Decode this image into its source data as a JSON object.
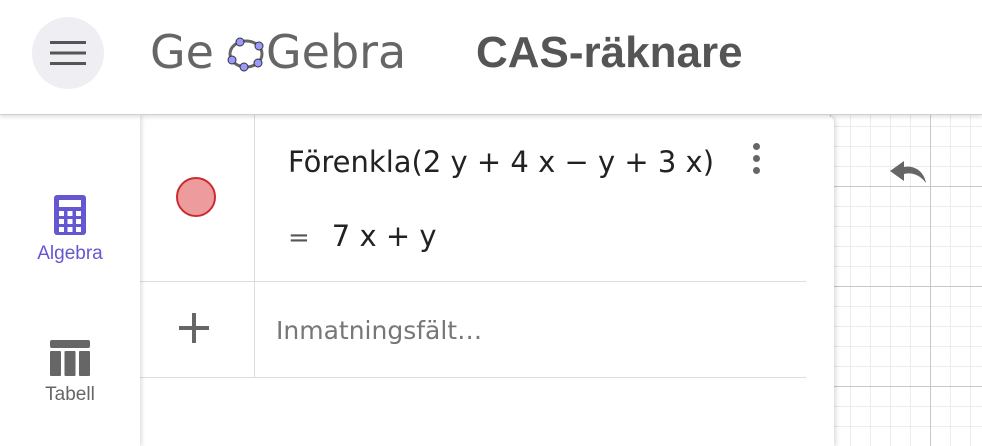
{
  "header": {
    "logo_text": "GeoGebra",
    "app_title": "CAS-räknare",
    "menu_icon": "hamburger-menu-icon"
  },
  "sidenav": {
    "items": [
      {
        "label": "Algebra",
        "icon": "calculator-icon",
        "active": true
      },
      {
        "label": "Tabell",
        "icon": "table-icon",
        "active": false
      }
    ]
  },
  "cas": {
    "rows": [
      {
        "input": "Förenkla(2 y + 4 x − y + 3 x)",
        "output_prefix": "=",
        "output": "7 x + y"
      }
    ],
    "input_placeholder": "Inmatningsfält…"
  },
  "graphics": {
    "undo_icon": "undo-icon"
  },
  "colors": {
    "accent": "#6557d2",
    "marble_fill": "#ee9b9d",
    "marble_border": "#cc2b2f"
  }
}
